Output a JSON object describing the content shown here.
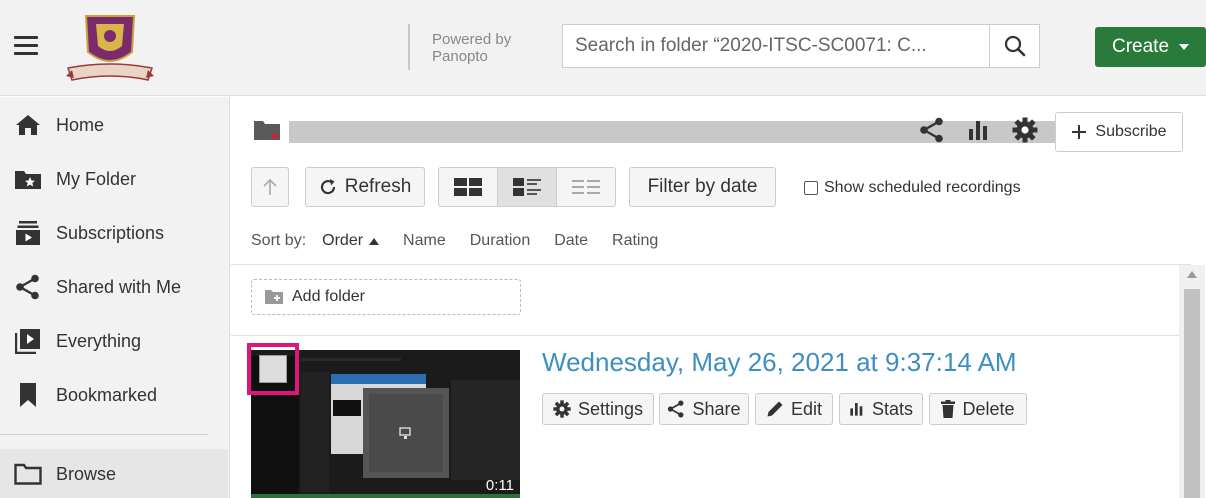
{
  "header": {
    "powered_line1": "Powered by",
    "powered_line2": "Panopto",
    "search_placeholder": "Search in folder “2020-ITSC-SC0071: C...",
    "create_label": "Create"
  },
  "sidebar": {
    "items": [
      {
        "label": "Home",
        "icon": "home-icon"
      },
      {
        "label": "My Folder",
        "icon": "my-folder-icon"
      },
      {
        "label": "Subscriptions",
        "icon": "subscriptions-icon"
      },
      {
        "label": "Shared with Me",
        "icon": "share-icon"
      },
      {
        "label": "Everything",
        "icon": "everything-icon"
      },
      {
        "label": "Bookmarked",
        "icon": "bookmark-icon"
      },
      {
        "label": "Browse",
        "icon": "browse-folder-icon"
      }
    ]
  },
  "folder": {
    "subscribe_label": "Subscribe"
  },
  "toolbar": {
    "refresh_label": "Refresh",
    "filter_label": "Filter by date",
    "scheduled_label": "Show scheduled recordings"
  },
  "sort": {
    "label": "Sort by:",
    "options": [
      "Order",
      "Name",
      "Duration",
      "Date",
      "Rating"
    ],
    "active": "Order"
  },
  "add_folder_label": "Add folder",
  "session": {
    "title": "Wednesday, May 26, 2021 at 9:37:14 AM",
    "duration": "0:11",
    "actions": [
      "Settings",
      "Share",
      "Edit",
      "Stats",
      "Delete"
    ]
  },
  "colors": {
    "create_green": "#2a7a3b",
    "link_blue": "#3d8fc2",
    "selection_pink": "#e0157a"
  }
}
